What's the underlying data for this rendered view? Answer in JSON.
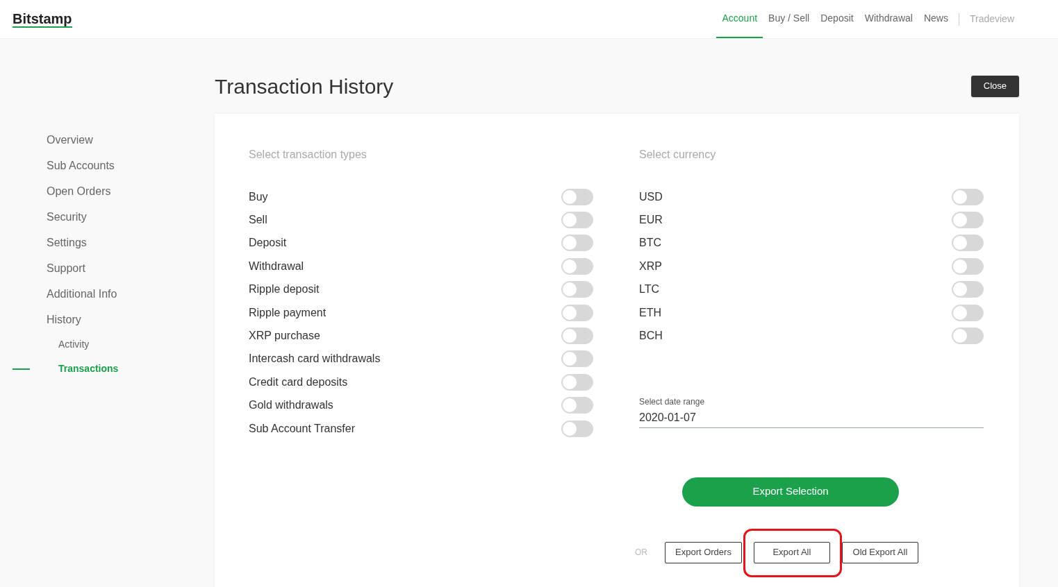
{
  "logo": "Bitstamp",
  "nav": [
    {
      "label": "Account",
      "selected": true
    },
    {
      "label": "Buy / Sell",
      "selected": false
    },
    {
      "label": "Deposit",
      "selected": false
    },
    {
      "label": "Withdrawal",
      "selected": false
    },
    {
      "label": "News",
      "selected": false
    }
  ],
  "nav_secondary": "Tradeview",
  "sidebar": {
    "items": [
      {
        "label": "Overview",
        "selected": false
      },
      {
        "label": "Sub Accounts",
        "selected": false
      },
      {
        "label": "Open Orders",
        "selected": false
      },
      {
        "label": "Security",
        "selected": false
      },
      {
        "label": "Settings",
        "selected": false
      },
      {
        "label": "Support",
        "selected": false
      },
      {
        "label": "Additional Info",
        "selected": false
      },
      {
        "label": "History",
        "selected": false,
        "children": [
          {
            "label": "Activity",
            "selected": false
          },
          {
            "label": "Transactions",
            "selected": true
          }
        ]
      }
    ]
  },
  "title": "Transaction History",
  "close_button": "Close",
  "transaction_types": {
    "heading": "Select transaction types",
    "items": [
      {
        "label": "Buy",
        "on": false
      },
      {
        "label": "Sell",
        "on": false
      },
      {
        "label": "Deposit",
        "on": false
      },
      {
        "label": "Withdrawal",
        "on": false
      },
      {
        "label": "Ripple deposit",
        "on": false
      },
      {
        "label": "Ripple payment",
        "on": false
      },
      {
        "label": "XRP purchase",
        "on": false
      },
      {
        "label": "Intercash card withdrawals",
        "on": false
      },
      {
        "label": "Credit card deposits",
        "on": false
      },
      {
        "label": "Gold withdrawals",
        "on": false
      },
      {
        "label": "Sub Account Transfer",
        "on": false
      }
    ]
  },
  "currencies": {
    "heading": "Select currency",
    "items": [
      {
        "label": "USD",
        "on": false
      },
      {
        "label": "EUR",
        "on": false
      },
      {
        "label": "BTC",
        "on": false
      },
      {
        "label": "XRP",
        "on": false
      },
      {
        "label": "LTC",
        "on": false
      },
      {
        "label": "ETH",
        "on": false
      },
      {
        "label": "BCH",
        "on": false
      }
    ]
  },
  "date_range": {
    "label": "Select date range",
    "value": "2020-01-07"
  },
  "export_selection": "Export Selection",
  "or_label": "OR",
  "export_buttons": [
    {
      "label": "Export Orders",
      "highlighted": false
    },
    {
      "label": "Export All",
      "highlighted": true
    },
    {
      "label": "Old Export All",
      "highlighted": false
    }
  ]
}
